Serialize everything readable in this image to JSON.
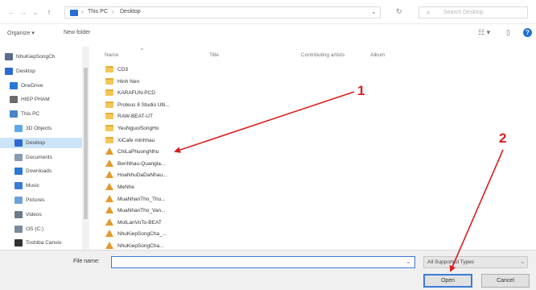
{
  "address": {
    "nav_back": "←",
    "nav_forward": "→",
    "nav_recent": "⌄",
    "nav_up": "↑",
    "path": [
      "This PC",
      "Desktop"
    ],
    "separator": "›",
    "dropdown": "⌄",
    "refresh": "↻",
    "search_icon": "⌕",
    "search_placeholder": "Search Desktop"
  },
  "toolbar": {
    "organize": "Organize ▾",
    "new_folder": "New folder",
    "view_icon": "☷ ▾",
    "pane_icon": "▯",
    "help": "?"
  },
  "sidebar": {
    "items": [
      {
        "label": "NhuKiepSongCh",
        "color": "#5a6b8c",
        "selected": false,
        "indent": 0
      },
      {
        "label": "Desktop",
        "color": "#2a6ad2",
        "selected": false,
        "indent": 0
      },
      {
        "label": "OneDrive",
        "color": "#2a78d6",
        "selected": false,
        "indent": 1
      },
      {
        "label": "HIEP PHAM",
        "color": "#6b6b6b",
        "selected": false,
        "indent": 1
      },
      {
        "label": "This PC",
        "color": "#4a86c8",
        "selected": false,
        "indent": 1
      },
      {
        "label": "3D Objects",
        "color": "#5fa8e8",
        "selected": false,
        "indent": 2
      },
      {
        "label": "Desktop",
        "color": "#2a6ad2",
        "selected": true,
        "indent": 2
      },
      {
        "label": "Documents",
        "color": "#8a9bb0",
        "selected": false,
        "indent": 2
      },
      {
        "label": "Downloads",
        "color": "#2a78d6",
        "selected": false,
        "indent": 2
      },
      {
        "label": "Music",
        "color": "#3b7bd8",
        "selected": false,
        "indent": 2
      },
      {
        "label": "Pictures",
        "color": "#6fa0d8",
        "selected": false,
        "indent": 2
      },
      {
        "label": "Videos",
        "color": "#6b7b8b",
        "selected": false,
        "indent": 2
      },
      {
        "label": "OS (C:)",
        "color": "#7a8a9a",
        "selected": false,
        "indent": 2
      },
      {
        "label": "Toshiba Canvio",
        "color": "#333333",
        "selected": false,
        "indent": 2
      }
    ]
  },
  "columns": {
    "name": "Name",
    "title": "Title",
    "artists": "Contributing artists",
    "album": "Album",
    "sort_caret": "^"
  },
  "files": [
    {
      "name": "CD3",
      "type": "folder"
    },
    {
      "name": "Hinh Nen",
      "type": "folder"
    },
    {
      "name": "KARAFUN-PCD",
      "type": "folder"
    },
    {
      "name": "Proteus 8 Studio Ulti...",
      "type": "folder"
    },
    {
      "name": "RAW-BEAT-UT",
      "type": "folder"
    },
    {
      "name": "YeuNguoiSongHo",
      "type": "folder"
    },
    {
      "name": "XiCafe minhhau",
      "type": "folder"
    },
    {
      "name": "ChiLaPhuongNhu",
      "type": "audio"
    },
    {
      "name": "BenNhau-Quangla...",
      "type": "audio"
    },
    {
      "name": "HoaNhuDaDaNhau...",
      "type": "audio"
    },
    {
      "name": "MeNhe",
      "type": "audio"
    },
    {
      "name": "MuaNhanTho_Thu...",
      "type": "audio"
    },
    {
      "name": "MuaNhanTho_Van...",
      "type": "audio"
    },
    {
      "name": "MotLanVoTo-BEAT",
      "type": "audio"
    },
    {
      "name": "NhuKiepSongCha_...",
      "type": "audio"
    },
    {
      "name": "NhuKiepSongCha...",
      "type": "audio"
    }
  ],
  "bottom": {
    "file_name_label": "File name:",
    "file_name_value": "",
    "caret": "⌄",
    "file_type": "All Supported Types",
    "open": "Open",
    "cancel": "Cancel"
  },
  "annotations": {
    "label_1": "1",
    "label_2": "2",
    "arrow_color": "#d62020"
  }
}
